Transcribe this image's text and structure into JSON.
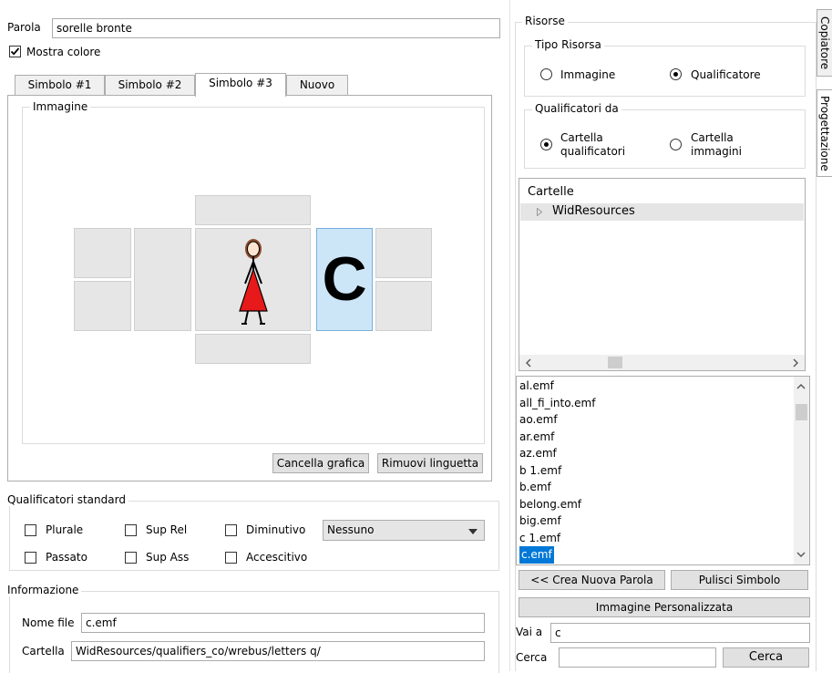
{
  "left": {
    "parola_label": "Parola",
    "parola_value": "sorelle bronte",
    "mostra_colore_label": "Mostra colore",
    "mostra_colore_checked": true,
    "tabs": [
      {
        "label": "Simbolo #1"
      },
      {
        "label": "Simbolo #2"
      },
      {
        "label": "Simbolo #3"
      },
      {
        "label": "Nuovo"
      }
    ],
    "active_tab": "Simbolo #3",
    "immagine_title": "Immagine",
    "qualifier_letter": "C",
    "cancella_grafica": "Cancella grafica",
    "rimuovi_linguetta": "Rimuovi linguetta",
    "qualificatori_title": "Qualificatori standard",
    "checkboxes": [
      {
        "label": "Plurale"
      },
      {
        "label": "Sup Rel"
      },
      {
        "label": "Diminutivo"
      },
      {
        "label": "Passato"
      },
      {
        "label": "Sup Ass"
      },
      {
        "label": "Accescitivo"
      }
    ],
    "dropdown_value": "Nessuno",
    "informazione_title": "Informazione",
    "nome_file_label": "Nome file",
    "nome_file_value": "c.emf",
    "cartella_label": "Cartella",
    "cartella_value": "WidResources/qualifiers_co/wrebus/letters q/"
  },
  "right": {
    "risorse_title": "Risorse",
    "tipo_risorsa_title": "Tipo Risorsa",
    "radio_immagine": "Immagine",
    "radio_qualificatore": "Qualificatore",
    "tipo_selected": "Qualificatore",
    "qualificatori_da_title": "Qualificatori da",
    "radio_cartella_q_line1": "Cartella",
    "radio_cartella_q_line2": "qualificatori",
    "radio_cartella_i_line1": "Cartella",
    "radio_cartella_i_line2": "immagini",
    "qualificatori_da_selected": "Cartella qualificatori",
    "tree_header": "Cartelle",
    "tree_root": "WidResources",
    "files": [
      "al.emf",
      "all_fi_into.emf",
      "ao.emf",
      "ar.emf",
      "az.emf",
      "b 1.emf",
      "b.emf",
      "belong.emf",
      "big.emf",
      "c 1.emf",
      "c.emf"
    ],
    "selected_file": "c.emf",
    "crea_nuova_parola": "<< Crea Nuova Parola",
    "pulisci_simbolo": "Pulisci Simbolo",
    "immagine_personalizzata": "Immagine Personalizzata",
    "vai_a_label": "Vai a",
    "vai_a_value": "c",
    "cerca_label": "Cerca",
    "cerca_value": "",
    "cerca_button": "Cerca"
  },
  "side_tabs": [
    {
      "label": "Copiatore"
    },
    {
      "label": "Progettazione"
    }
  ],
  "colors": {
    "selection": "#0078d7",
    "qualifier_cell": "#cde6f7",
    "figure_dress": "#e8191a",
    "figure_hair": "#8b4a2b"
  },
  "icons": {
    "tree_expand": "triangle-right-icon",
    "scroll_left": "chevron-left-icon",
    "scroll_right": "chevron-right-icon",
    "scroll_up": "chevron-up-icon",
    "scroll_down": "chevron-down-icon",
    "dropdown": "chevron-down-icon",
    "checkmark": "check-icon",
    "figure": "girl-figure-icon"
  }
}
